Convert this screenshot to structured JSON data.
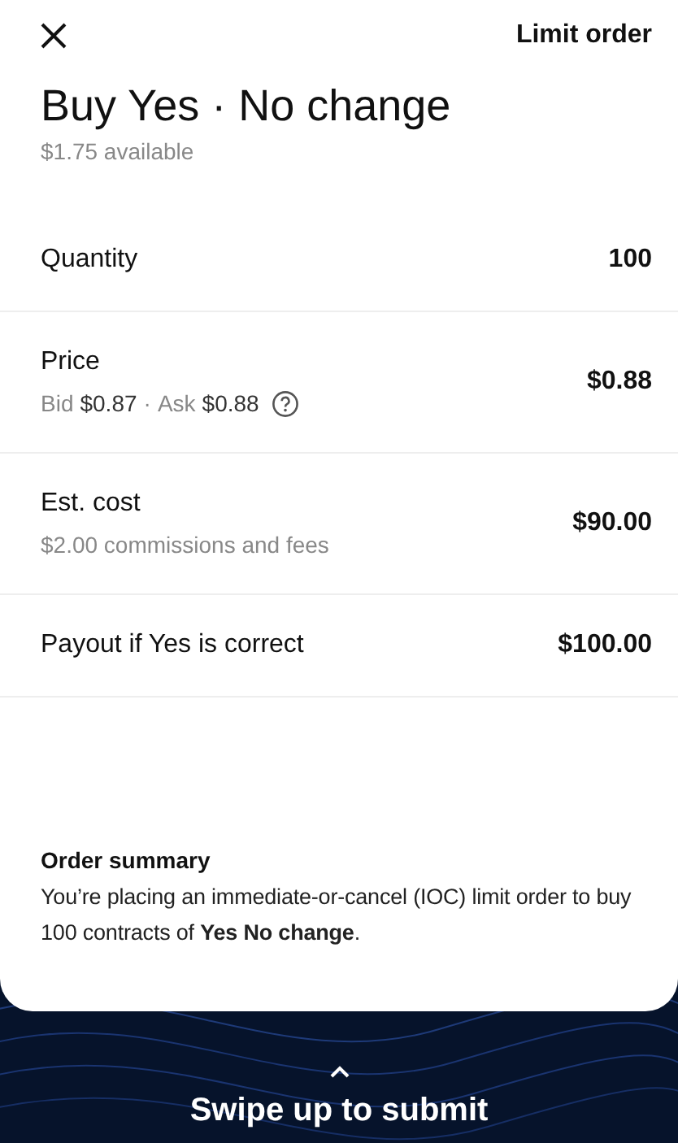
{
  "header": {
    "order_type": "Limit order"
  },
  "title": "Buy Yes · No change",
  "available": "$1.75 available",
  "rows": [
    {
      "kind": "plain",
      "label": "Quantity",
      "value": "100"
    },
    {
      "kind": "quote",
      "label": "Price",
      "value": "$0.88",
      "quote": [
        {
          "label": "Bid",
          "value": "$0.87"
        },
        {
          "label": "Ask",
          "value": "$0.88"
        }
      ],
      "separator": "·"
    },
    {
      "kind": "note",
      "label": "Est. cost",
      "value": "$90.00",
      "note": "$2.00 commissions and fees"
    },
    {
      "kind": "plain",
      "label": "Payout if Yes is correct",
      "value": "$100.00"
    }
  ],
  "summary": {
    "title": "Order summary",
    "body": "You’re placing an immediate-or-cancel (IOC) limit order to buy 100 contracts of **Yes No change**."
  },
  "submit": {
    "label": "Swipe up to submit"
  }
}
